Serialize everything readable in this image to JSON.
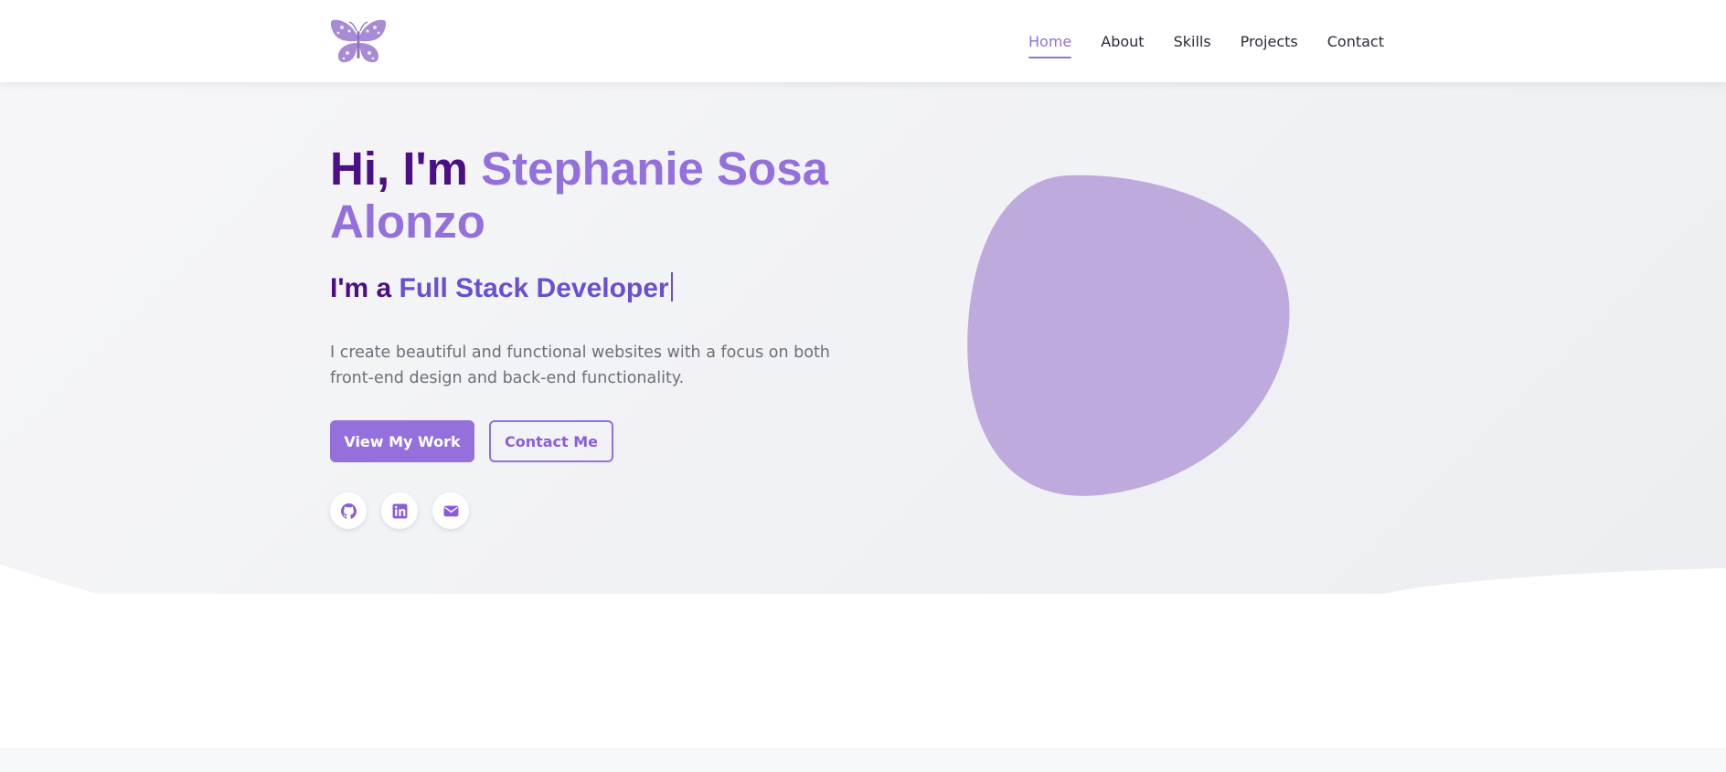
{
  "header": {
    "logo_name": "butterfly-logo",
    "nav": [
      {
        "label": "Home",
        "active": true
      },
      {
        "label": "About",
        "active": false
      },
      {
        "label": "Skills",
        "active": false
      },
      {
        "label": "Projects",
        "active": false
      },
      {
        "label": "Contact",
        "active": false
      }
    ],
    "theme_toggle_icon": "moon-icon"
  },
  "hero": {
    "greeting": "Hi, I'm ",
    "name": "Stephanie Sosa Alonzo",
    "subtitle_prefix": "I'm a ",
    "role": "Full Stack Developer",
    "description": "I create beautiful and functional websites with a focus on both front-end design and back-end functionality.",
    "primary_button": "View My Work",
    "secondary_button": "Contact Me",
    "social": [
      "github-icon",
      "linkedin-icon",
      "email-icon"
    ]
  },
  "colors": {
    "accent": "#9370db",
    "heading": "#4b0f86",
    "blob": "#bfaade",
    "toggle": "#f5a623"
  }
}
